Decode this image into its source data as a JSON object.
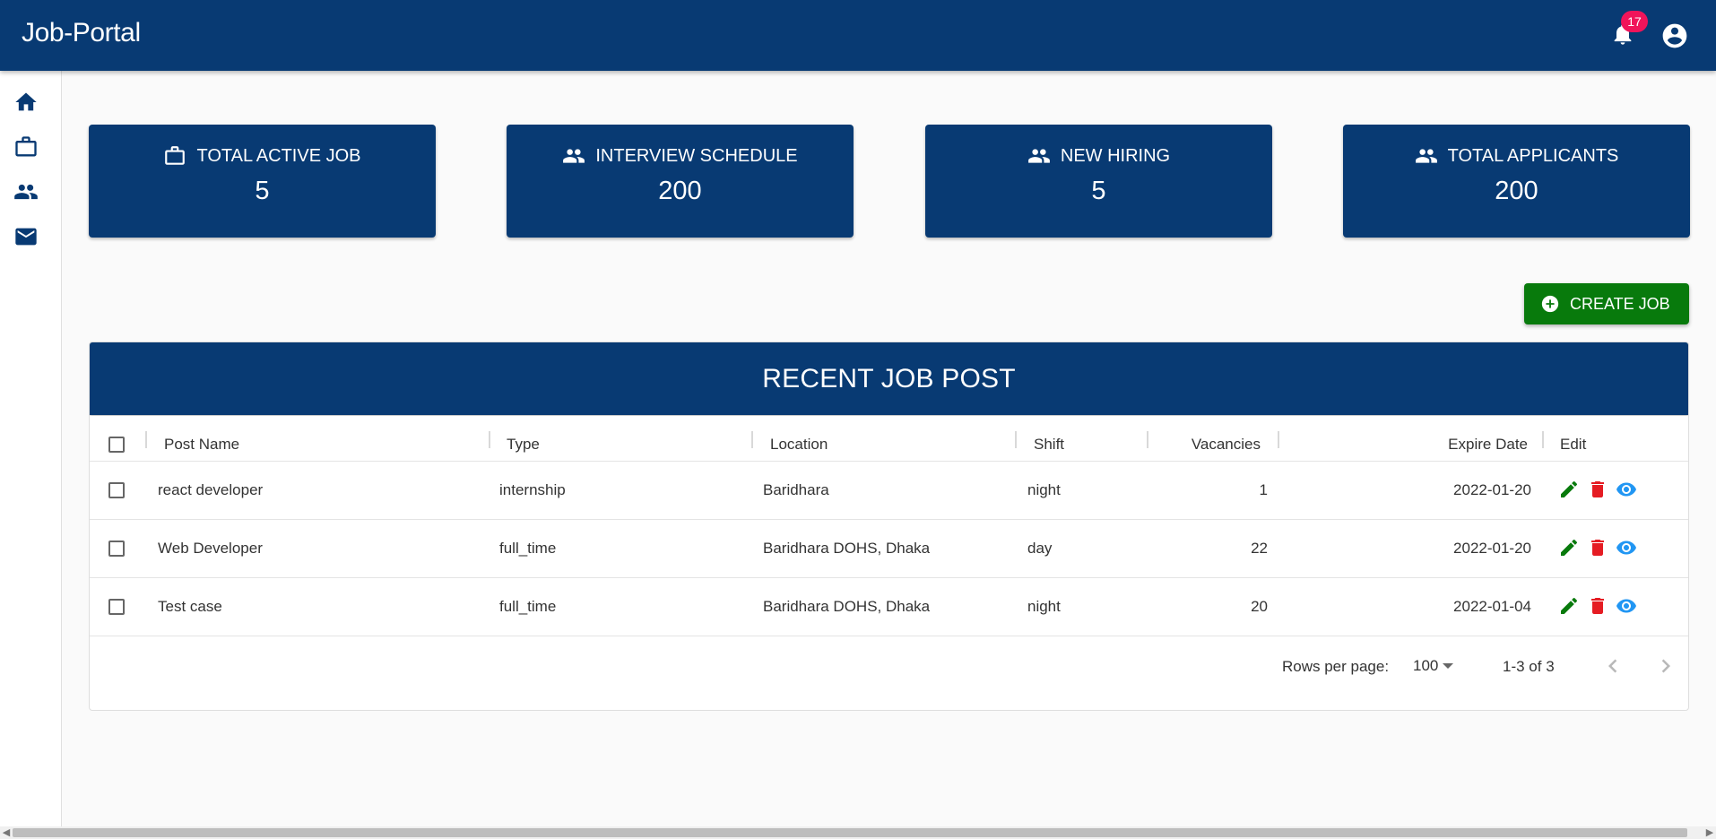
{
  "app": {
    "title": "Job-Portal",
    "notification_count": "17"
  },
  "sidebar": {
    "icons": [
      "home-icon",
      "briefcase-icon",
      "people-icon",
      "mail-icon"
    ]
  },
  "stats": [
    {
      "label": "TOTAL ACTIVE JOB",
      "value": "5",
      "icon": "briefcase-icon"
    },
    {
      "label": "INTERVIEW SCHEDULE",
      "value": "200",
      "icon": "people-icon"
    },
    {
      "label": "NEW HIRING",
      "value": "5",
      "icon": "people-icon"
    },
    {
      "label": "TOTAL APPLICANTS",
      "value": "200",
      "icon": "people-icon"
    }
  ],
  "actions": {
    "create_job_label": "CREATE JOB"
  },
  "table": {
    "title": "RECENT JOB POST",
    "headers": {
      "post_name": "Post Name",
      "type": "Type",
      "location": "Location",
      "shift": "Shift",
      "vacancies": "Vacancies",
      "expire_date": "Expire Date",
      "edit": "Edit"
    },
    "rows": [
      {
        "post_name": "react developer",
        "type": "internship",
        "location": "Baridhara",
        "shift": "night",
        "vacancies": "1",
        "expire_date": "2022-01-20"
      },
      {
        "post_name": "Web Developer",
        "type": "full_time",
        "location": "Baridhara DOHS, Dhaka",
        "shift": "day",
        "vacancies": "22",
        "expire_date": "2022-01-20"
      },
      {
        "post_name": "Test case",
        "type": "full_time",
        "location": "Baridhara DOHS, Dhaka",
        "shift": "night",
        "vacancies": "20",
        "expire_date": "2022-01-04"
      }
    ]
  },
  "pagination": {
    "rows_per_page_label": "Rows per page:",
    "rows_per_page_value": "100",
    "range": "1-3 of 3"
  },
  "colors": {
    "primary": "#083a73",
    "success": "#087a0c",
    "danger": "#e51c23",
    "info": "#2196f3",
    "badge": "#f0145a"
  }
}
